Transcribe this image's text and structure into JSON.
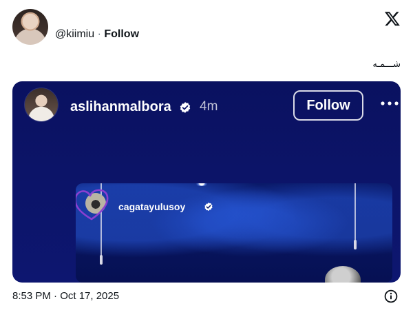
{
  "header": {
    "handle": "@kiimiu",
    "separator": " · ",
    "follow_label": "Follow"
  },
  "tweet": {
    "text": "شـــمـه",
    "timestamp": "8:53 PM · Oct 17, 2025"
  },
  "story": {
    "username": "aslihanmalbora",
    "time_ago": "4m",
    "follow_label": "Follow",
    "inner": {
      "username": "cagatayulusoy"
    }
  },
  "icons": {
    "logo": "x-logo-icon",
    "verified": "verified-badge-icon",
    "more": "more-dots-icon",
    "info": "info-icon",
    "heart": "heart-doodle-icon"
  },
  "colors": {
    "story_bg": "#0c1468",
    "text": "#0f1419",
    "secondary_text": "#536471",
    "verified_fill": "#ffffff",
    "heart": "#8b3fd1"
  }
}
